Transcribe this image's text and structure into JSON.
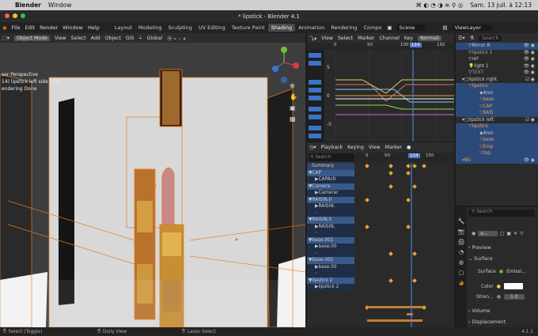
{
  "macbar": {
    "app": "Blender",
    "menu_window": "Window",
    "datetime": "Sam. 13 juil. à 12:13"
  },
  "window": {
    "title": "* lipstick - Blender 4.1"
  },
  "menubar": {
    "items": [
      "File",
      "Edit",
      "Render",
      "Window",
      "Help"
    ],
    "workspaces": [
      "Layout",
      "Modeling",
      "Sculpting",
      "UV Editing",
      "Texture Paint",
      "Shading",
      "Animation",
      "Rendering",
      "Compo"
    ],
    "active_workspace": "Shading",
    "scene": "Scene",
    "view_layer": "ViewLayer"
  },
  "viewport": {
    "mode": "Object Mode",
    "menus": [
      "View",
      "Select",
      "Add",
      "Object",
      "GIS"
    ],
    "orientation": "Global",
    "overlay_line1": "ser Perspective",
    "overlay_line2": "14) lipstick left side | BG",
    "overlay_line3": "endering Done"
  },
  "graph_editor": {
    "menus": [
      "View",
      "Select",
      "Marker",
      "Channel",
      "Key"
    ],
    "normalize": "Normali",
    "ticks": [
      "0",
      "50",
      "100",
      "114",
      "150"
    ],
    "yticks": [
      "5",
      "0",
      "-5"
    ]
  },
  "dopesheet": {
    "menus": [
      "Playback",
      "Keying",
      "View",
      "Marker"
    ],
    "search_placeholder": "Search",
    "ticks": [
      "0",
      "50",
      "114",
      "150"
    ],
    "channels": [
      "Summary",
      "CAP",
      "CAPActi",
      "Camera",
      "Camerar",
      "RAISIN.0",
      "RAISIN.",
      "RAISIN.0",
      "RAISIN.",
      "base.001",
      "base.00",
      "base.002",
      "base.00",
      "lipstick 2",
      "lipstick 2"
    ]
  },
  "outliner": {
    "search_placeholder": "Search",
    "items": [
      "Mirror R",
      "lipstick 1",
      "ref",
      "light 1",
      "TEXT",
      "lipstick right",
      "lipstick",
      "Anin",
      "base",
      "CAP",
      "RAIS",
      "lipstick left",
      "lipstick",
      "Anin",
      "base",
      "Emp",
      "top.",
      "BG"
    ]
  },
  "properties": {
    "search_placeholder": "Search",
    "material_name": "e...",
    "sections": {
      "preview": "Preview",
      "surface": "Surface",
      "volume": "Volume",
      "displacement": "Displacement"
    },
    "surface_label": "Surface",
    "surface_value": "Emissi...",
    "color_label": "Color",
    "strength_label": "Stren...",
    "strength_value": "1.0"
  },
  "statusbar": {
    "select": "Select (Toggle)",
    "dolly": "Dolly View",
    "lasso": "Lasso Select",
    "version": "4.1.1"
  },
  "colors": {
    "accent": "#4a7fd4",
    "key": "#e8a43a",
    "selection": "#2b4a7a",
    "playhead": "#4e7bd6"
  }
}
